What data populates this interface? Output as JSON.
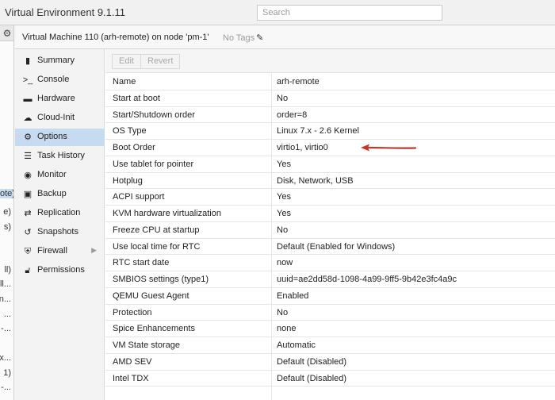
{
  "header": {
    "app_title": "Virtual Environment 9.1.11",
    "search_placeholder": "Search"
  },
  "tree": {
    "items": [
      {
        "label": "ote)",
        "selected": true
      },
      {
        "label": "e)"
      },
      {
        "label": "s)"
      },
      {
        "label": "ll)"
      },
      {
        "label": "ll..."
      },
      {
        "label": "n..."
      },
      {
        "label": "..."
      },
      {
        "label": "-..."
      },
      {
        "label": "x..."
      },
      {
        "label": "1)"
      },
      {
        "label": "-..."
      }
    ]
  },
  "vm": {
    "title": "Virtual Machine 110 (arh-remote) on node 'pm-1'",
    "tags": "No Tags"
  },
  "nav": {
    "items": [
      {
        "label": "Summary",
        "icon": "book-icon"
      },
      {
        "label": "Console",
        "icon": "terminal-icon"
      },
      {
        "label": "Hardware",
        "icon": "desktop-icon"
      },
      {
        "label": "Cloud-Init",
        "icon": "cloud-icon"
      },
      {
        "label": "Options",
        "icon": "gear-icon",
        "active": true
      },
      {
        "label": "Task History",
        "icon": "list-icon"
      },
      {
        "label": "Monitor",
        "icon": "eye-icon"
      },
      {
        "label": "Backup",
        "icon": "floppy-icon"
      },
      {
        "label": "Replication",
        "icon": "retweet-icon"
      },
      {
        "label": "Snapshots",
        "icon": "history-icon"
      },
      {
        "label": "Firewall",
        "icon": "shield-icon",
        "has_submenu": true
      },
      {
        "label": "Permissions",
        "icon": "unlock-icon"
      }
    ]
  },
  "toolbar": {
    "edit_label": "Edit",
    "revert_label": "Revert"
  },
  "options": [
    {
      "key": "Name",
      "value": "arh-remote"
    },
    {
      "key": "Start at boot",
      "value": "No"
    },
    {
      "key": "Start/Shutdown order",
      "value": "order=8"
    },
    {
      "key": "OS Type",
      "value": "Linux 7.x - 2.6 Kernel"
    },
    {
      "key": "Boot Order",
      "value": "virtio1, virtio0"
    },
    {
      "key": "Use tablet for pointer",
      "value": "Yes"
    },
    {
      "key": "Hotplug",
      "value": "Disk, Network, USB"
    },
    {
      "key": "ACPI support",
      "value": "Yes"
    },
    {
      "key": "KVM hardware virtualization",
      "value": "Yes"
    },
    {
      "key": "Freeze CPU at startup",
      "value": "No"
    },
    {
      "key": "Use local time for RTC",
      "value": "Default (Enabled for Windows)"
    },
    {
      "key": "RTC start date",
      "value": "now"
    },
    {
      "key": "SMBIOS settings (type1)",
      "value": "uuid=ae2dd58d-1098-4a99-9ff5-9b42e3fc4a9c"
    },
    {
      "key": "QEMU Guest Agent",
      "value": "Enabled"
    },
    {
      "key": "Protection",
      "value": "No"
    },
    {
      "key": "Spice Enhancements",
      "value": "none"
    },
    {
      "key": "VM State storage",
      "value": "Automatic"
    },
    {
      "key": "AMD SEV",
      "value": "Default (Disabled)"
    },
    {
      "key": "Intel TDX",
      "value": "Default (Disabled)"
    }
  ],
  "colors": {
    "selection": "#c6dbef",
    "annotation_arrow": "#c0392b"
  }
}
